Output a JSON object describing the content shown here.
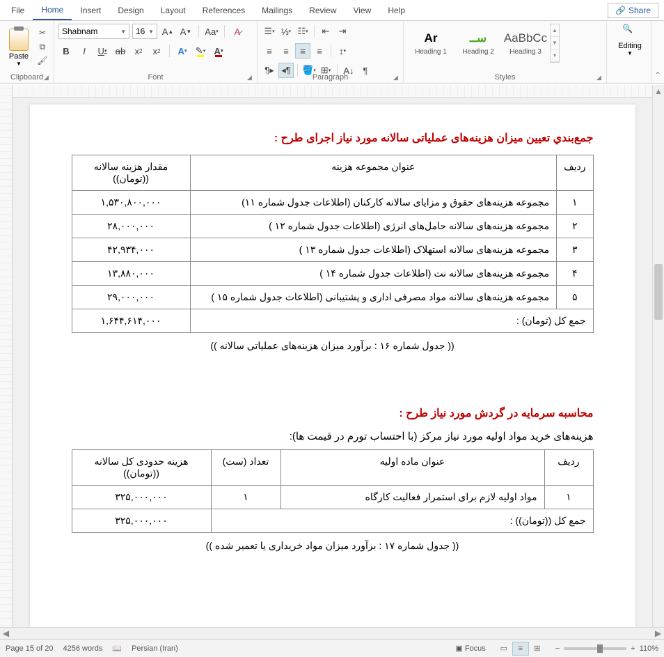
{
  "menu": {
    "items": [
      "File",
      "Home",
      "Insert",
      "Design",
      "Layout",
      "References",
      "Mailings",
      "Review",
      "View",
      "Help"
    ],
    "active": "Home",
    "share": "Share"
  },
  "ribbon": {
    "clipboard": {
      "paste": "Paste",
      "label": "Clipboard"
    },
    "font": {
      "name": "Shabnam",
      "size": "16",
      "label": "Font"
    },
    "paragraph": {
      "label": "Paragraph"
    },
    "styles": {
      "items": [
        {
          "preview": "Ar",
          "name": "Heading 1",
          "cls": "h1"
        },
        {
          "preview": "ســ",
          "name": "Heading 2",
          "cls": "h2"
        },
        {
          "preview": "AaBbCc",
          "name": "Heading 3",
          "cls": "h3"
        }
      ],
      "label": "Styles"
    },
    "editing": {
      "label": "Editing"
    }
  },
  "document": {
    "heading1": "جمع‌بندي تعيين ميزان هزينه‌های عملياتی سالانه مورد نياز اجرای طرح :",
    "table1": {
      "headers": [
        "رديف",
        "عنوان مجموعه  هزينه",
        "مقدار هزينه سالانه ((تومان))"
      ],
      "rows": [
        {
          "n": "۱",
          "title": "مجموعه هزينه‌های حقوق و مزايای سالانه كاركنان (اطلاعات جدول شماره ۱۱)",
          "amount": "۱,۵۳۰,۸۰۰,۰۰۰"
        },
        {
          "n": "۲",
          "title": "مجموعه هزينه‌های سالانه حامل‌های انرژی (اطلاعات جدول شماره ۱۲ )",
          "amount": "۲۸,۰۰۰,۰۰۰"
        },
        {
          "n": "۳",
          "title": "مجموعه هزينه‌های سالانه استهلاک (اطلاعات جدول شماره ۱۳ )",
          "amount": "۴۲,۹۳۴,۰۰۰"
        },
        {
          "n": "۴",
          "title": "مجموعه هزينه‌های سالانه نت (اطلاعات جدول شماره ۱۴ )",
          "amount": "۱۳,۸۸۰,۰۰۰"
        },
        {
          "n": "۵",
          "title": "مجموعه هزينه‌های سالانه مواد مصرفی اداری و پشتيبانی (اطلاعات جدول شماره ۱۵ )",
          "amount": "۲۹,۰۰۰,۰۰۰"
        }
      ],
      "total_label": "جمع كل (تومان) :",
      "total": "۱,۶۴۴,۶۱۴,۰۰۰"
    },
    "caption1": "(( جدول شماره ۱۶ : برآورد ميزان هزينه‌های عملياتی سالانه ))",
    "heading2": "محاسبه سرمايه در گردش مورد نياز طرح :",
    "sub2": "هزينه‌های خريد مواد اوليه مورد نياز مركز (با احتساب تورم در قيمت ها):",
    "table2": {
      "headers": [
        "رديف",
        "عنوان ماده اوليه",
        "تعداد (ست)",
        "هزينه حدودی كل سالانه ((تومان))"
      ],
      "rows": [
        {
          "n": "۱",
          "title": "مواد اوليه لازم برای استمرار فعاليت كارگاه",
          "qty": "۱",
          "amount": "۳۲۵,۰۰۰,۰۰۰"
        }
      ],
      "total_label": "جمع كل ((تومان)) :",
      "total": "۳۲۵,۰۰۰,۰۰۰"
    },
    "caption2": "(( جدول شماره ۱۷ : برآورد ميزان مواد خريداری يا تعمير شده ))"
  },
  "status": {
    "page": "Page 15 of 20",
    "words": "4256 words",
    "lang": "Persian (Iran)",
    "focus": "Focus",
    "zoom": "110%"
  }
}
